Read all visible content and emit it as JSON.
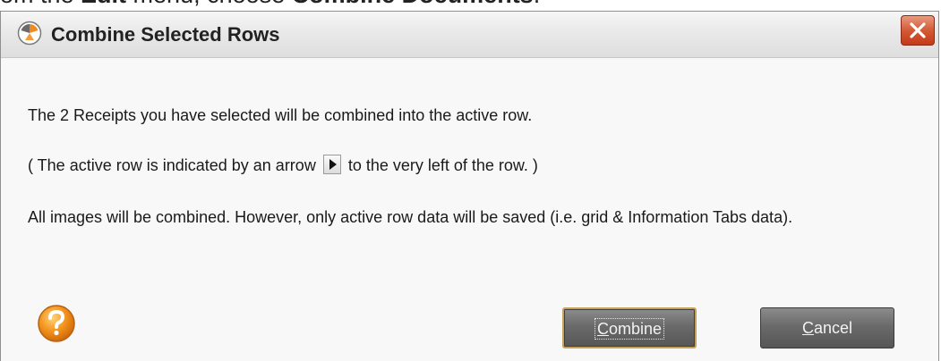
{
  "background_caption": {
    "prefix": "om the ",
    "bold_menu": "Edit",
    "middle": " menu, choose ",
    "bold_command": "Combine Documents",
    "suffix": "."
  },
  "dialog": {
    "title": "Combine Selected Rows",
    "title_icon": "app-logo-icon",
    "close_icon": "close-x-icon"
  },
  "message": {
    "line1": "The 2 Receipts you have selected will be combined into the active row.",
    "line2_before": "( The active row is indicated by an arrow",
    "line2_after": "to the very left of the row. )",
    "arrow_icon": "row-pointer-arrow-icon",
    "line3": "All images will be combined. However, only active row data will be saved (i.e. grid & Information Tabs data)."
  },
  "buttons": {
    "help_icon": "help-question-icon",
    "combine_first": "C",
    "combine_rest": "ombine",
    "cancel_first": "C",
    "cancel_rest": "ancel"
  },
  "colors": {
    "close_button": "#d45a35",
    "help_icon": "#f08a1c",
    "button_bg": "#6a6a6a",
    "default_button_border": "#c7a05a"
  }
}
